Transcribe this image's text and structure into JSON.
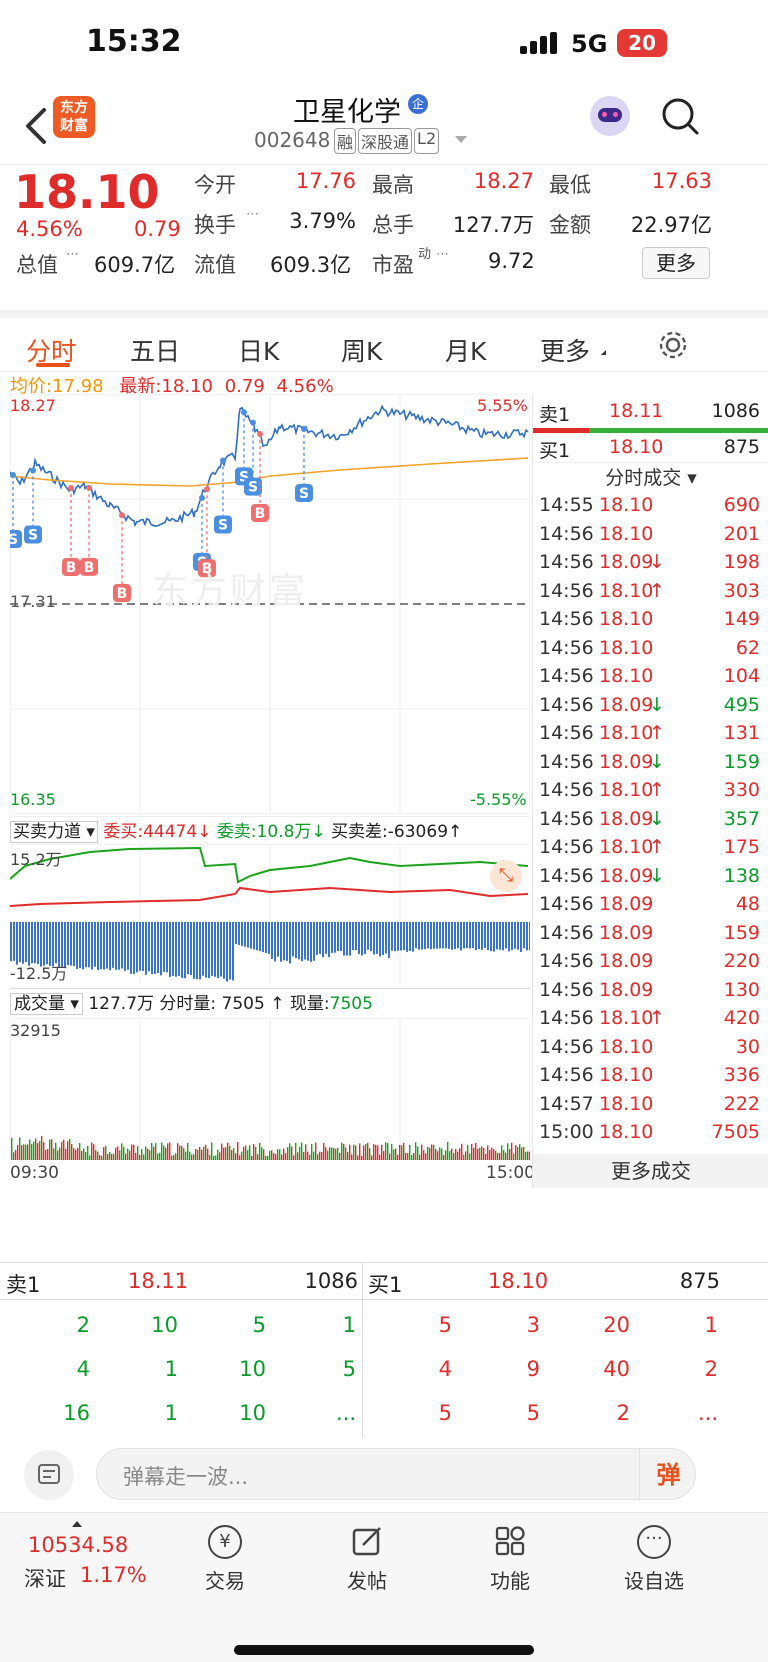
{
  "status": {
    "time": "15:32",
    "network": "5G",
    "battery": "20"
  },
  "header": {
    "badge_line1": "东方",
    "badge_line2": "财富",
    "title": "卫星化学",
    "title_badge": "企",
    "code": "002648",
    "tags": [
      "融",
      "深股通",
      "L2"
    ]
  },
  "quote": {
    "price": "18.10",
    "pct": "4.56%",
    "chg": "0.79",
    "fields": [
      {
        "label": "今开",
        "value": "17.76",
        "color": "red"
      },
      {
        "label": "最高",
        "value": "18.27",
        "color": "red"
      },
      {
        "label": "最低",
        "value": "17.63",
        "color": "red"
      },
      {
        "label": "换手",
        "value": "3.79%",
        "color": "dark"
      },
      {
        "label": "总手",
        "value": "127.7万",
        "color": "dark"
      },
      {
        "label": "金额",
        "value": "22.97亿",
        "color": "dark"
      },
      {
        "label": "总值",
        "value": "609.7亿",
        "color": "dark"
      },
      {
        "label": "流值",
        "value": "609.3亿",
        "color": "dark"
      },
      {
        "label": "市盈",
        "sup": "动",
        "value": "9.72",
        "color": "dark"
      }
    ],
    "more_button": "更多"
  },
  "tabs": [
    "分时",
    "五日",
    "日K",
    "周K",
    "月K",
    "更多"
  ],
  "tabs_active": 0,
  "avg_line": {
    "avg_label": "均价:",
    "avg_value": "17.98",
    "latest_label": "最新:",
    "latest_value": "18.10",
    "latest_chg": "0.79",
    "latest_pct": "4.56%"
  },
  "intraday": {
    "y_top": "18.27",
    "y_bottom": "16.35",
    "pct_top": "5.55%",
    "pct_bottom": "-5.55%",
    "pre_close": "17.31",
    "watermark": "东方财富",
    "markers": [
      {
        "t": "S",
        "x": 0.045,
        "c": "blue"
      },
      {
        "t": "S",
        "x": 0.006,
        "c": "blue"
      },
      {
        "t": "B",
        "x": 0.118,
        "c": "red"
      },
      {
        "t": "B",
        "x": 0.152,
        "c": "red"
      },
      {
        "t": "B",
        "x": 0.215,
        "c": "red"
      },
      {
        "t": "S",
        "x": 0.37,
        "c": "blue"
      },
      {
        "t": "B",
        "x": 0.378,
        "c": "red"
      },
      {
        "t": "S",
        "x": 0.41,
        "c": "blue"
      },
      {
        "t": "S",
        "x": 0.45,
        "c": "blue"
      },
      {
        "t": "S",
        "x": 0.468,
        "c": "blue"
      },
      {
        "t": "B",
        "x": 0.48,
        "c": "red"
      },
      {
        "t": "S",
        "x": 0.565,
        "c": "blue"
      }
    ]
  },
  "power": {
    "label": "买卖力道",
    "buy": "委买:44474",
    "sell": "委卖:10.8万",
    "diff": "买卖差:-63069",
    "top": "15.2万",
    "bottom": "-12.5万"
  },
  "volume": {
    "label": "成交量",
    "total": "127.7万",
    "fen": "分时量: 7505",
    "now_label": "现量:",
    "now": "7505",
    "max": "32915",
    "t_start": "09:30",
    "t_end": "15:00"
  },
  "book_top": {
    "ask_label": "卖1",
    "ask_price": "18.11",
    "ask_vol": "1086",
    "bid_label": "买1",
    "bid_price": "18.10",
    "bid_vol": "875"
  },
  "ticks_header": "分时成交",
  "ticks": [
    [
      "14:55",
      "18.10",
      "690",
      "r",
      ""
    ],
    [
      "14:56",
      "18.10",
      "201",
      "r",
      ""
    ],
    [
      "14:56",
      "18.09",
      "198",
      "r",
      "↓"
    ],
    [
      "14:56",
      "18.10",
      "303",
      "r",
      "↑"
    ],
    [
      "14:56",
      "18.10",
      "149",
      "r",
      ""
    ],
    [
      "14:56",
      "18.10",
      "62",
      "r",
      ""
    ],
    [
      "14:56",
      "18.10",
      "104",
      "r",
      ""
    ],
    [
      "14:56",
      "18.09",
      "495",
      "g",
      "↓"
    ],
    [
      "14:56",
      "18.10",
      "131",
      "r",
      "↑"
    ],
    [
      "14:56",
      "18.09",
      "159",
      "g",
      "↓"
    ],
    [
      "14:56",
      "18.10",
      "330",
      "r",
      "↑"
    ],
    [
      "14:56",
      "18.09",
      "357",
      "g",
      "↓"
    ],
    [
      "14:56",
      "18.10",
      "175",
      "r",
      "↑"
    ],
    [
      "14:56",
      "18.09",
      "138",
      "g",
      "↓"
    ],
    [
      "14:56",
      "18.09",
      "48",
      "r",
      ""
    ],
    [
      "14:56",
      "18.09",
      "159",
      "r",
      ""
    ],
    [
      "14:56",
      "18.09",
      "220",
      "r",
      ""
    ],
    [
      "14:56",
      "18.09",
      "130",
      "r",
      ""
    ],
    [
      "14:56",
      "18.10",
      "420",
      "r",
      "↑"
    ],
    [
      "14:56",
      "18.10",
      "30",
      "r",
      ""
    ],
    [
      "14:56",
      "18.10",
      "336",
      "r",
      ""
    ],
    [
      "14:57",
      "18.10",
      "222",
      "r",
      ""
    ],
    [
      "15:00",
      "18.10",
      "7505",
      "r",
      ""
    ]
  ],
  "more_ticks": "更多成交",
  "book": {
    "ask_label": "卖1",
    "ask_price": "18.11",
    "ask_vol": "1086",
    "bid_label": "买1",
    "bid_price": "18.10",
    "bid_vol": "875",
    "ask_rows": [
      [
        "2",
        "10",
        "5",
        "1"
      ],
      [
        "4",
        "1",
        "10",
        "5"
      ],
      [
        "16",
        "1",
        "10",
        "..."
      ]
    ],
    "bid_rows": [
      [
        "5",
        "3",
        "20",
        "1"
      ],
      [
        "4",
        "9",
        "40",
        "2"
      ],
      [
        "5",
        "5",
        "2",
        "..."
      ]
    ]
  },
  "danmu": {
    "placeholder": "弹幕走一波...",
    "btn": "弹"
  },
  "nav": {
    "index_value": "10534.58",
    "index_name": "深证",
    "index_pct": "1.17%",
    "items": [
      "交易",
      "发帖",
      "功能",
      "设自选"
    ]
  },
  "colors": {
    "red": "#e02b2b",
    "green": "#0a9a2a",
    "blue": "#2f6fc1",
    "orange": "#f39800",
    "accent": "#e8521e"
  }
}
